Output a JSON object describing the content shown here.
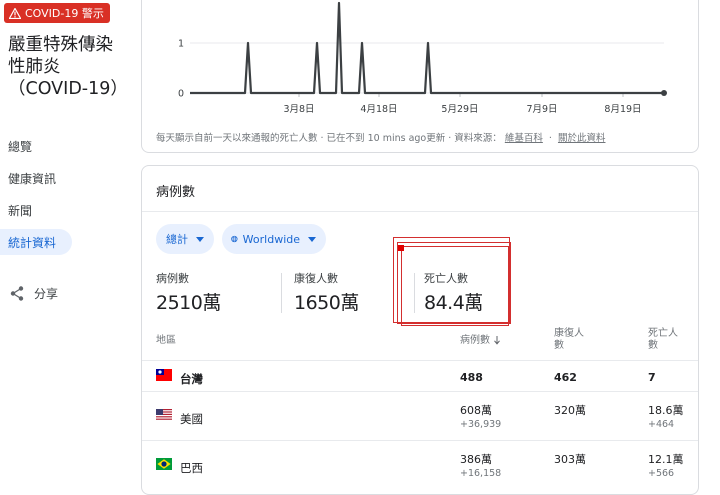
{
  "alert": {
    "label": "COVID-19 警示",
    "icon": "warning-icon",
    "color": "#d93025"
  },
  "disease": {
    "title_line1": "嚴重特殊傳染",
    "title_line2": "性肺炎",
    "title_line3": "（COVID-19）"
  },
  "nav": {
    "items": [
      {
        "label": "總覽",
        "active": false
      },
      {
        "label": "健康資訊",
        "active": false
      },
      {
        "label": "新聞",
        "active": false
      },
      {
        "label": "統計資料",
        "active": true
      }
    ],
    "share_label": "分享",
    "share_icon": "share-icon",
    "active_color": "#1967d2"
  },
  "chart_data": {
    "type": "line",
    "y_ticks": [
      "0",
      "1"
    ],
    "x_ticks": [
      "3月8日",
      "4月18日",
      "5月29日",
      "7月9日",
      "8月19日"
    ],
    "ylim": [
      0,
      1.8
    ],
    "series": [
      {
        "values_desc": "daily deaths, mostly 0 with spikes",
        "points": [
          {
            "x": "2月下旬",
            "y": 1
          },
          {
            "x": "3月下旬",
            "y": 1
          },
          {
            "x": "4月初",
            "y": 1.8
          },
          {
            "x": "4月中旬",
            "y": 1
          },
          {
            "x": "5月中旬",
            "y": 1
          }
        ]
      }
    ],
    "line_color": "#3c4043",
    "grid": true
  },
  "chart_footer": {
    "note": "每天顯示自前一天以來通報的死亡人數 · 已在不到 10 mins ago更新 · 資料來源：",
    "link1": "維基百科",
    "link2": "關於此資料"
  },
  "stats": {
    "title": "病例數",
    "filter_total": "總計",
    "filter_region": "Worldwide",
    "globe_icon": "globe-icon",
    "metrics": [
      {
        "label": "病例數",
        "value": "2510萬"
      },
      {
        "label": "康復人數",
        "value": "1650萬"
      },
      {
        "label": "死亡人數",
        "value": "84.4萬"
      }
    ],
    "table": {
      "headers": {
        "region": "地區",
        "cases": "病例數",
        "recovered_l1": "康復人",
        "recovered_l2": "數",
        "deaths_l1": "死亡人",
        "deaths_l2": "數"
      },
      "sort_icon": "arrow-down-icon",
      "rows": [
        {
          "flag": "taiwan-flag-icon",
          "country": "台灣",
          "cases": "488",
          "cases_delta": "",
          "recovered": "462",
          "deaths": "7",
          "deaths_delta": ""
        },
        {
          "flag": "usa-flag-icon",
          "country": "美國",
          "cases": "608萬",
          "cases_delta": "+36,939",
          "recovered": "320萬",
          "deaths": "18.6萬",
          "deaths_delta": "+464"
        },
        {
          "flag": "brazil-flag-icon",
          "country": "巴西",
          "cases": "386萬",
          "cases_delta": "+16,158",
          "recovered": "303萬",
          "deaths": "12.1萬",
          "deaths_delta": "+566"
        }
      ]
    }
  }
}
